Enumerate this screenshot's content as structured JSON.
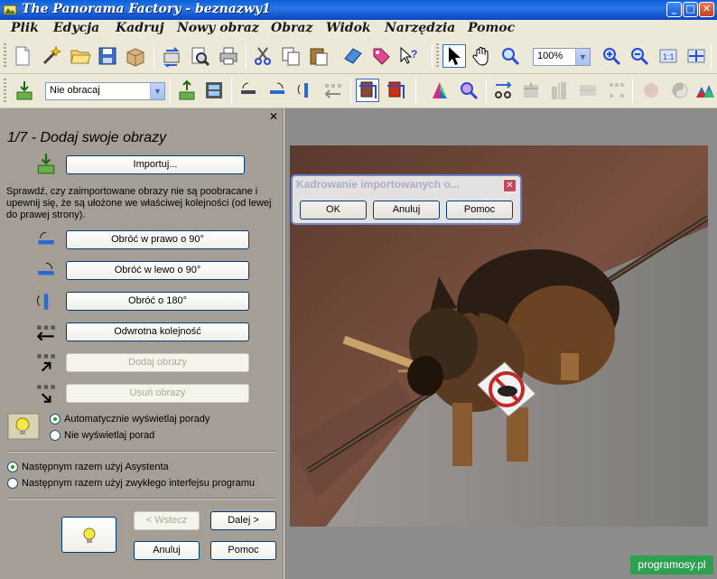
{
  "window": {
    "title": "The Panorama Factory - beznazwy1",
    "minimize": "_",
    "maximize": "□",
    "close": "✕"
  },
  "menu": [
    "Plik",
    "Edycja",
    "Kadruj",
    "Nowy obraz",
    "Obraz",
    "Widok",
    "Narzędzia",
    "Pomoc"
  ],
  "toolbar1": {
    "icons": [
      "new-document-icon",
      "wizard-icon",
      "open-folder-icon",
      "save-icon",
      "package-icon",
      "transfer-icon",
      "print-preview-icon",
      "print-icon",
      "cut-icon",
      "copy-icon",
      "paste-icon",
      "eraser-icon",
      "tag-icon",
      "help-pointer-icon",
      "pointer-icon",
      "hand-icon",
      "zoom-icon",
      "zoom-in-icon",
      "zoom-out-icon",
      "actual-size-icon",
      "fit-icon"
    ],
    "zoom_value": "100%"
  },
  "toolbar2": {
    "rotate_select": "Nie obracaj",
    "icons": [
      "import-icon",
      "export-icon",
      "filmstrip-icon",
      "rotate-right-icon",
      "rotate-left-icon",
      "rotate-180-icon",
      "reverse-order-icon",
      "crop-icon",
      "crop-red-icon",
      "color-triangle-icon",
      "magnifier-color-icon",
      "align-icon",
      "stitch-icon",
      "blend-icon",
      "grid-icon",
      "sphere-icon",
      "yin-yang-icon",
      "histogram-icon"
    ]
  },
  "panel": {
    "close": "✕",
    "step_title": "1/7 - Dodaj swoje obrazy",
    "import_button": "Importuj...",
    "description": "Sprawdź, czy zaimportowane obrazy nie są poobracane i upewnij się, że są ułożone we właściwej kolejności (od lewej do prawej strony).",
    "rotate_right": "Obróć w prawo o 90°",
    "rotate_left": "Obróć w lewo o 90°",
    "rotate_180": "Obróć o 180°",
    "reverse_order": "Odwrotna kolejność",
    "add_images": "Dodaj obrazy",
    "remove_images": "Usuń obrazy",
    "tips_auto": "Automatycznie wyświetlaj porady",
    "tips_none": "Nie wyświetlaj porad",
    "next_time_wizard": "Następnym razem użyj Asystenta",
    "next_time_normal": "Następnym razem użyj zwykłego interfejsu programu",
    "back": "< Wstecz",
    "next": "Dalej >",
    "cancel": "Anuluj",
    "help": "Pomoc"
  },
  "dialog": {
    "title": "Kadrowanie importowanych o...",
    "ok": "OK",
    "cancel": "Anuluj",
    "help": "Pomoc",
    "close": "✕"
  },
  "watermark": "programosy.pl"
}
